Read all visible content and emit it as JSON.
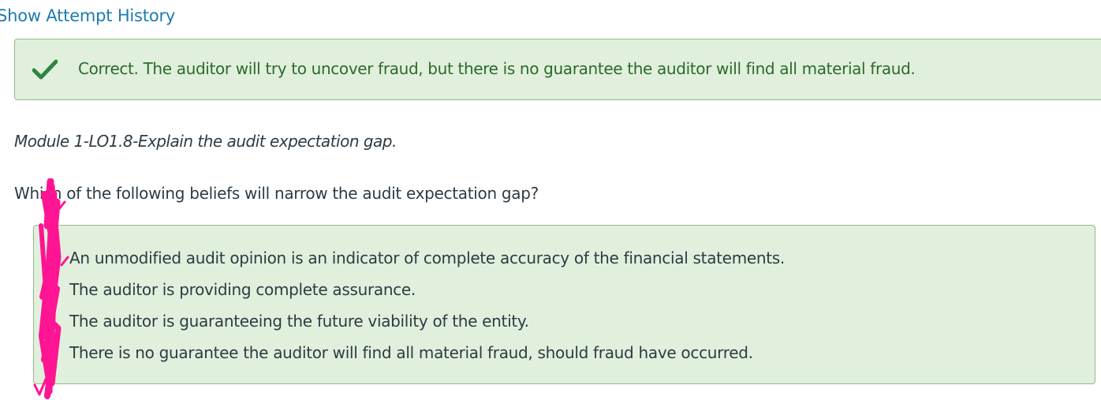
{
  "header": {
    "attempt_history_link": "Show Attempt History"
  },
  "feedback": {
    "status": "correct",
    "icon": "checkmark-icon",
    "message": "Correct. The auditor will try to uncover fraud, but there is no guarantee the auditor will find all material fraud."
  },
  "question": {
    "module": "Module 1-LO1.8-Explain the audit expectation gap.",
    "prompt": "Which of the following beliefs will narrow the audit expectation gap?",
    "answers": [
      {
        "label": "An unmodified audit opinion is an indicator of complete accuracy of the financial statements."
      },
      {
        "label": "The auditor is providing complete assurance."
      },
      {
        "label": "The auditor is guaranteeing the future viability of the entity."
      },
      {
        "label": "There is no guarantee the auditor will find all material fraud, should fraud have occurred."
      }
    ]
  },
  "colors": {
    "link": "#1e7ab3",
    "success_bg": "#e1f0dc",
    "success_border": "#94ba86",
    "success_text": "#2b6a2b",
    "check": "#2e8540",
    "scribble": "#ff1493"
  }
}
